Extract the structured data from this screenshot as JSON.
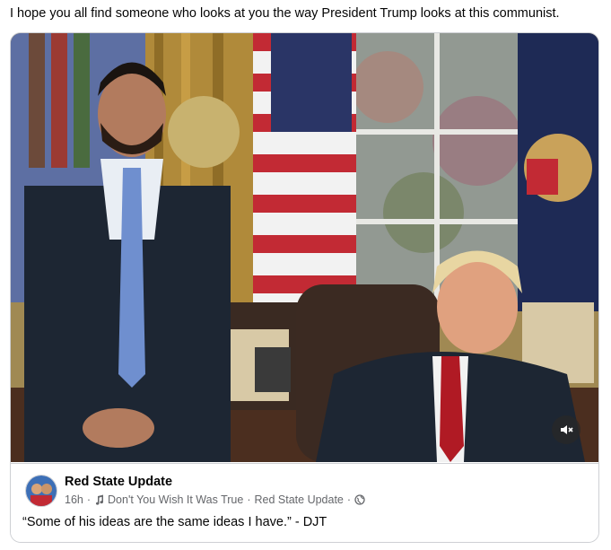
{
  "post": {
    "caption": "I hope you all find someone who looks at you the way President Trump looks at this communist."
  },
  "shared": {
    "page_name": "Red State Update",
    "time": "16h",
    "audio_label": "Don't You Wish It Was True",
    "artist": "Red State Update",
    "audience_icon": "globe-icon",
    "separator": "·",
    "quote": "“Some of his ideas are the same ideas I have.” - DJT"
  },
  "media": {
    "mute_icon": "speaker-muted-icon"
  },
  "colors": {
    "text_primary": "#050505",
    "text_secondary": "#65676b",
    "border": "#ced0d4",
    "tie_blue": "#6f8fcf",
    "tie_red": "#b01a24"
  }
}
